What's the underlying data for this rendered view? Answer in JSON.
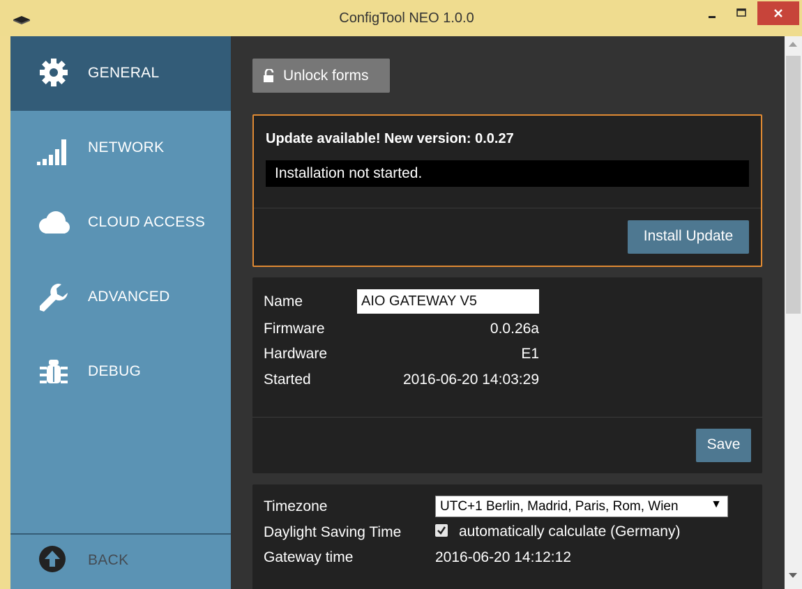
{
  "window": {
    "title": "ConfigTool NEO 1.0.0",
    "min_glyph": "–",
    "max_glyph": "□",
    "close_glyph": "✕"
  },
  "sidebar": {
    "items": [
      {
        "label": "GENERAL",
        "icon": "gear-icon",
        "active": true
      },
      {
        "label": "NETWORK",
        "icon": "signal-bars-icon",
        "active": false
      },
      {
        "label": "CLOUD ACCESS",
        "icon": "cloud-icon",
        "active": false
      },
      {
        "label": "ADVANCED",
        "icon": "wrench-icon",
        "active": false
      },
      {
        "label": "DEBUG",
        "icon": "bug-icon",
        "active": false
      }
    ],
    "back": {
      "label": "BACK",
      "icon": "arrow-up-circle-icon"
    }
  },
  "main": {
    "unlock_label": "Unlock forms",
    "update": {
      "title": "Update available! New version: 0.0.27",
      "status": "Installation not started.",
      "install_label": "Install Update"
    },
    "info": {
      "name_label": "Name",
      "name_value": "AIO GATEWAY V5",
      "firmware_label": "Firmware",
      "firmware_value": "0.0.26a",
      "hardware_label": "Hardware",
      "hardware_value": "E1",
      "started_label": "Started",
      "started_value": "2016-06-20 14:03:29",
      "save_label": "Save"
    },
    "time": {
      "timezone_label": "Timezone",
      "timezone_value": "UTC+1  Berlin, Madrid, Paris, Rom, Wien",
      "dst_label": "Daylight Saving Time",
      "dst_checked": true,
      "dst_option": "automatically calculate (Germany)",
      "gateway_time_label": "Gateway time",
      "gateway_time_value": "2016-06-20 14:12:12"
    }
  },
  "colors": {
    "titlebar": "#efdc8f",
    "sidebar": "#5b93b4",
    "sidebar_active": "#335c78",
    "main_bg": "#333333",
    "panel_bg": "#222222",
    "update_border": "#e08a33",
    "button_blue": "#4e7891",
    "close_red": "#c7443a"
  }
}
